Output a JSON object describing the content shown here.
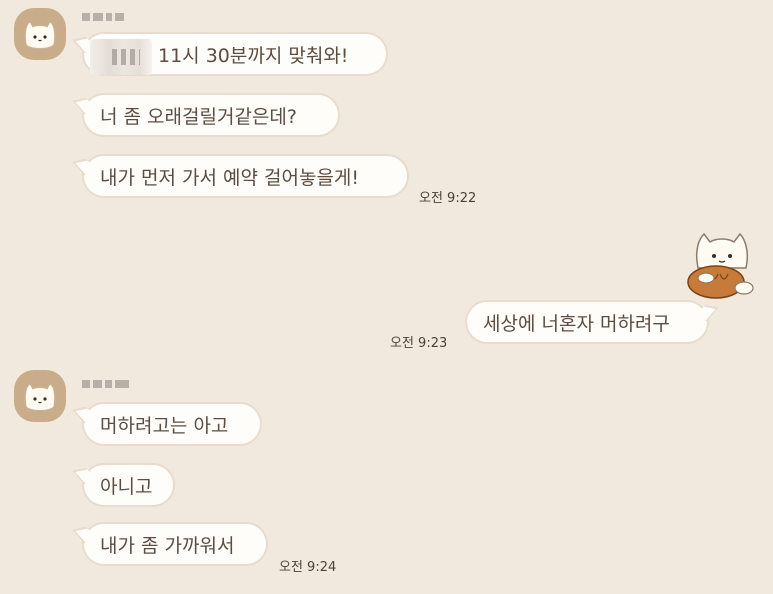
{
  "chat": {
    "group1": {
      "messages": [
        "11시 30분까지 맞춰와!",
        "너 좀 오래걸릴거같은데?",
        "내가 먼저 가서 예약 걸어놓을게!"
      ],
      "time": "오전 9:22"
    },
    "mine": {
      "message": "세상에 너혼자 머하려구",
      "time": "오전 9:23"
    },
    "group2": {
      "messages": [
        "머하려고는 아고",
        "아니고",
        "내가 좀 가까워서"
      ],
      "time": "오전 9:24"
    }
  },
  "icons": {
    "avatar": "cat-face-icon",
    "sticker": "cat-with-bread-sticker"
  },
  "colors": {
    "background": "#f1e9de",
    "bubble": "#fffdf9",
    "bubble_border": "#e7dccd",
    "avatar": "#c9ad8a",
    "text": "#5d4d41"
  }
}
